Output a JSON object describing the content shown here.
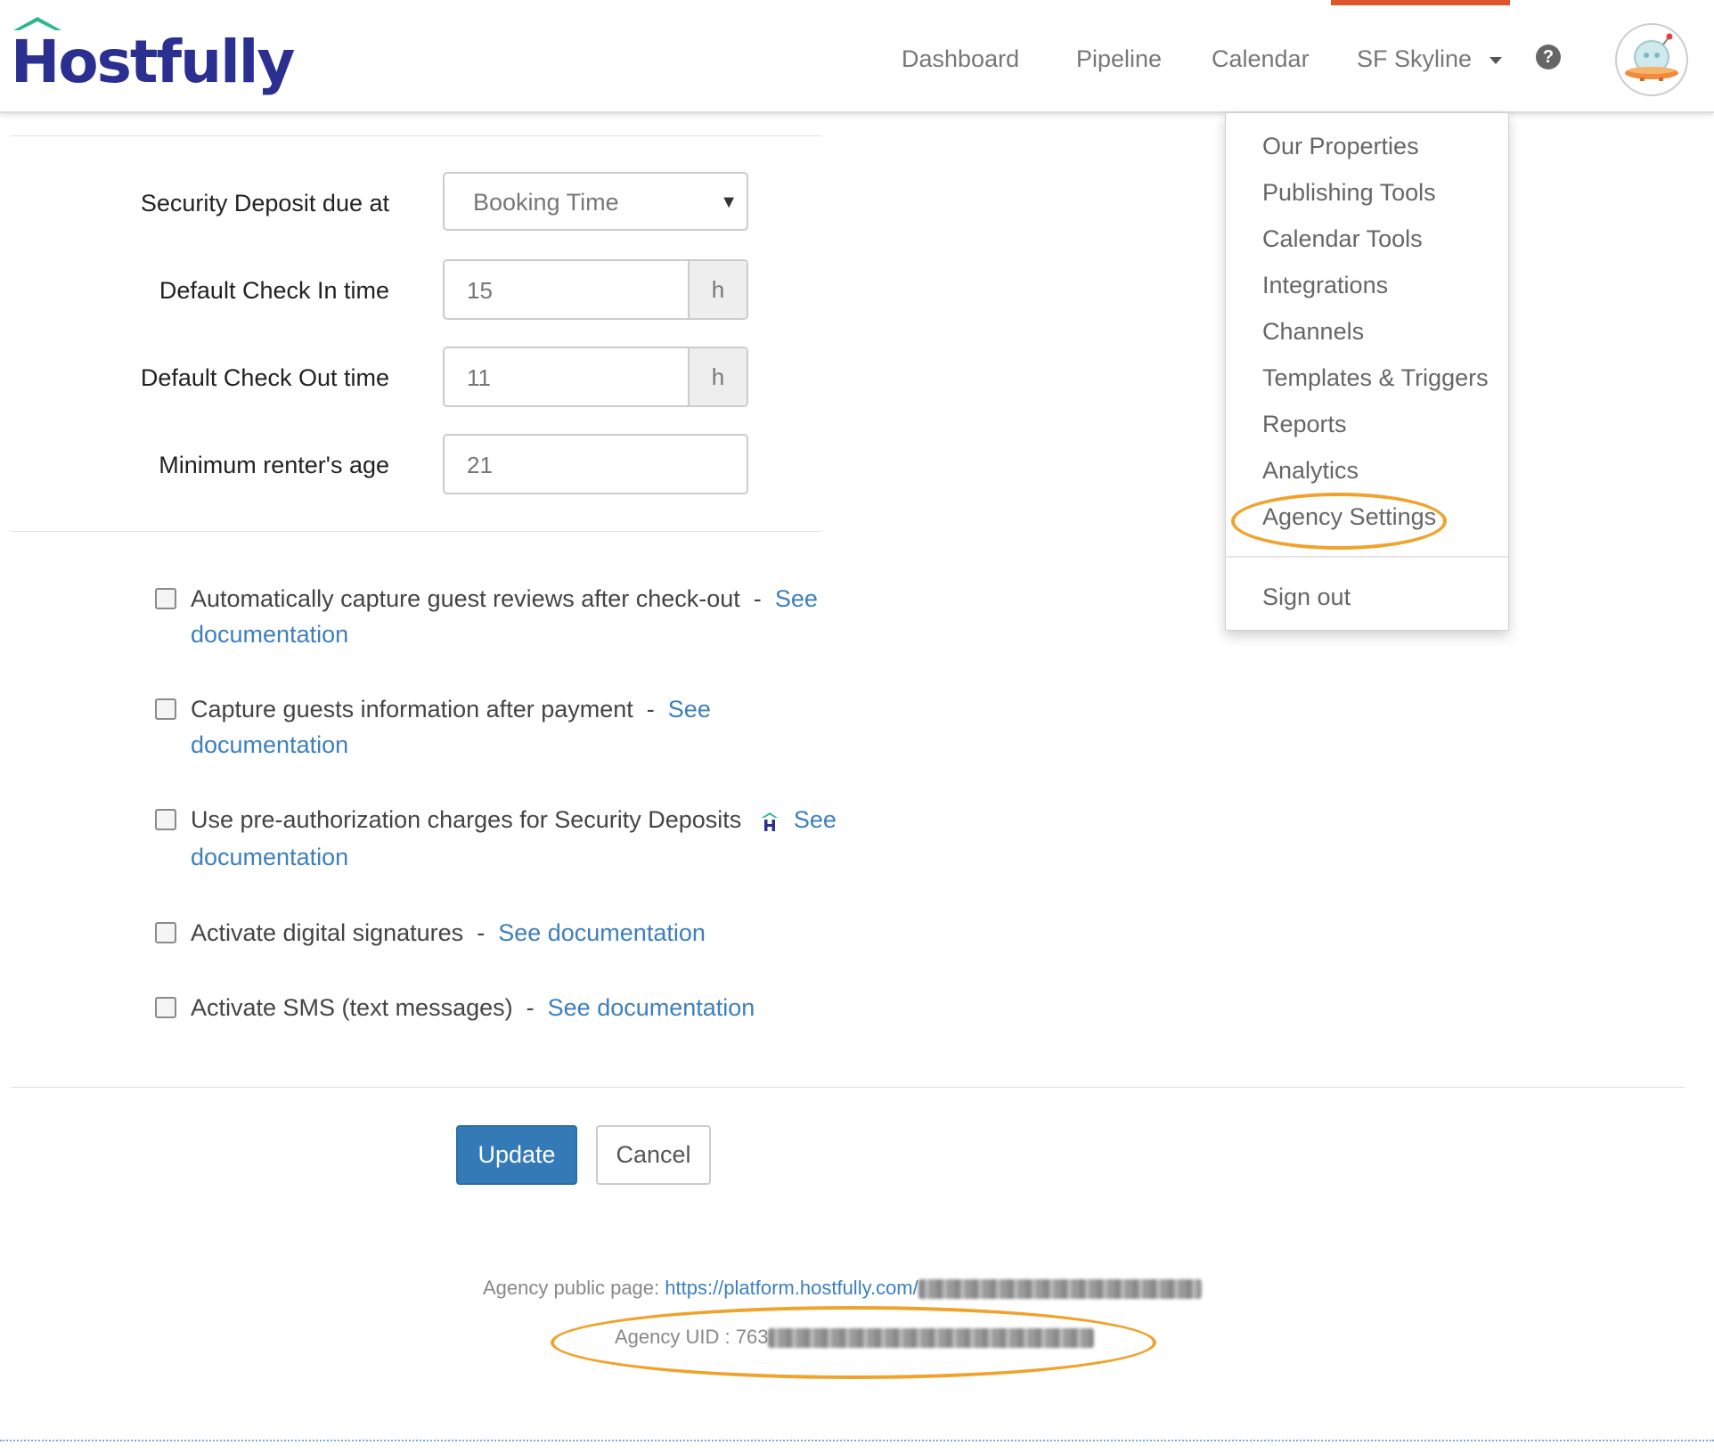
{
  "header": {
    "logo_text": "Hostfully",
    "nav": {
      "dashboard": "Dashboard",
      "pipeline": "Pipeline",
      "calendar": "Calendar",
      "account": "SF Skyline"
    },
    "help_icon": "question-circle-icon",
    "accent_color": "#e0552d",
    "brand_color": "#2b2f8f"
  },
  "dropdown": {
    "items": [
      "Our Properties",
      "Publishing Tools",
      "Calendar Tools",
      "Integrations",
      "Channels",
      "Templates & Triggers",
      "Reports",
      "Analytics",
      "Agency Settings"
    ],
    "sign_out": "Sign out",
    "highlight_color": "#f0a22a"
  },
  "form": {
    "security_deposit": {
      "label": "Security Deposit due at",
      "value": "Booking Time"
    },
    "check_in": {
      "label": "Default Check In time",
      "value": "15",
      "unit": "h"
    },
    "check_out": {
      "label": "Default Check Out time",
      "value": "11",
      "unit": "h"
    },
    "min_age": {
      "label": "Minimum renter's age",
      "value": "21"
    }
  },
  "options": [
    {
      "text": "Automatically capture guest reviews after check-out",
      "sep": "-",
      "link_a": "See",
      "link_b": "documentation",
      "checked": false
    },
    {
      "text": "Capture guests information after payment",
      "sep": "-",
      "link_a": "See",
      "link_b": "documentation",
      "checked": false
    },
    {
      "text": "Use pre-authorization charges for Security Deposits",
      "link_a": "See",
      "link_b": "documentation",
      "checked": false,
      "icon": "hostfully-logo-icon"
    },
    {
      "text": "Activate digital signatures",
      "sep": "-",
      "link": "See documentation",
      "checked": false
    },
    {
      "text": "Activate SMS (text messages)",
      "sep": "-",
      "link": "See documentation",
      "checked": false
    }
  ],
  "buttons": {
    "update": "Update",
    "cancel": "Cancel",
    "primary_color": "#337ab7"
  },
  "footer": {
    "public_page_label": "Agency public page:",
    "public_page_url": "https://platform.hostfully.com/",
    "uid_label": "Agency UID : 763"
  }
}
